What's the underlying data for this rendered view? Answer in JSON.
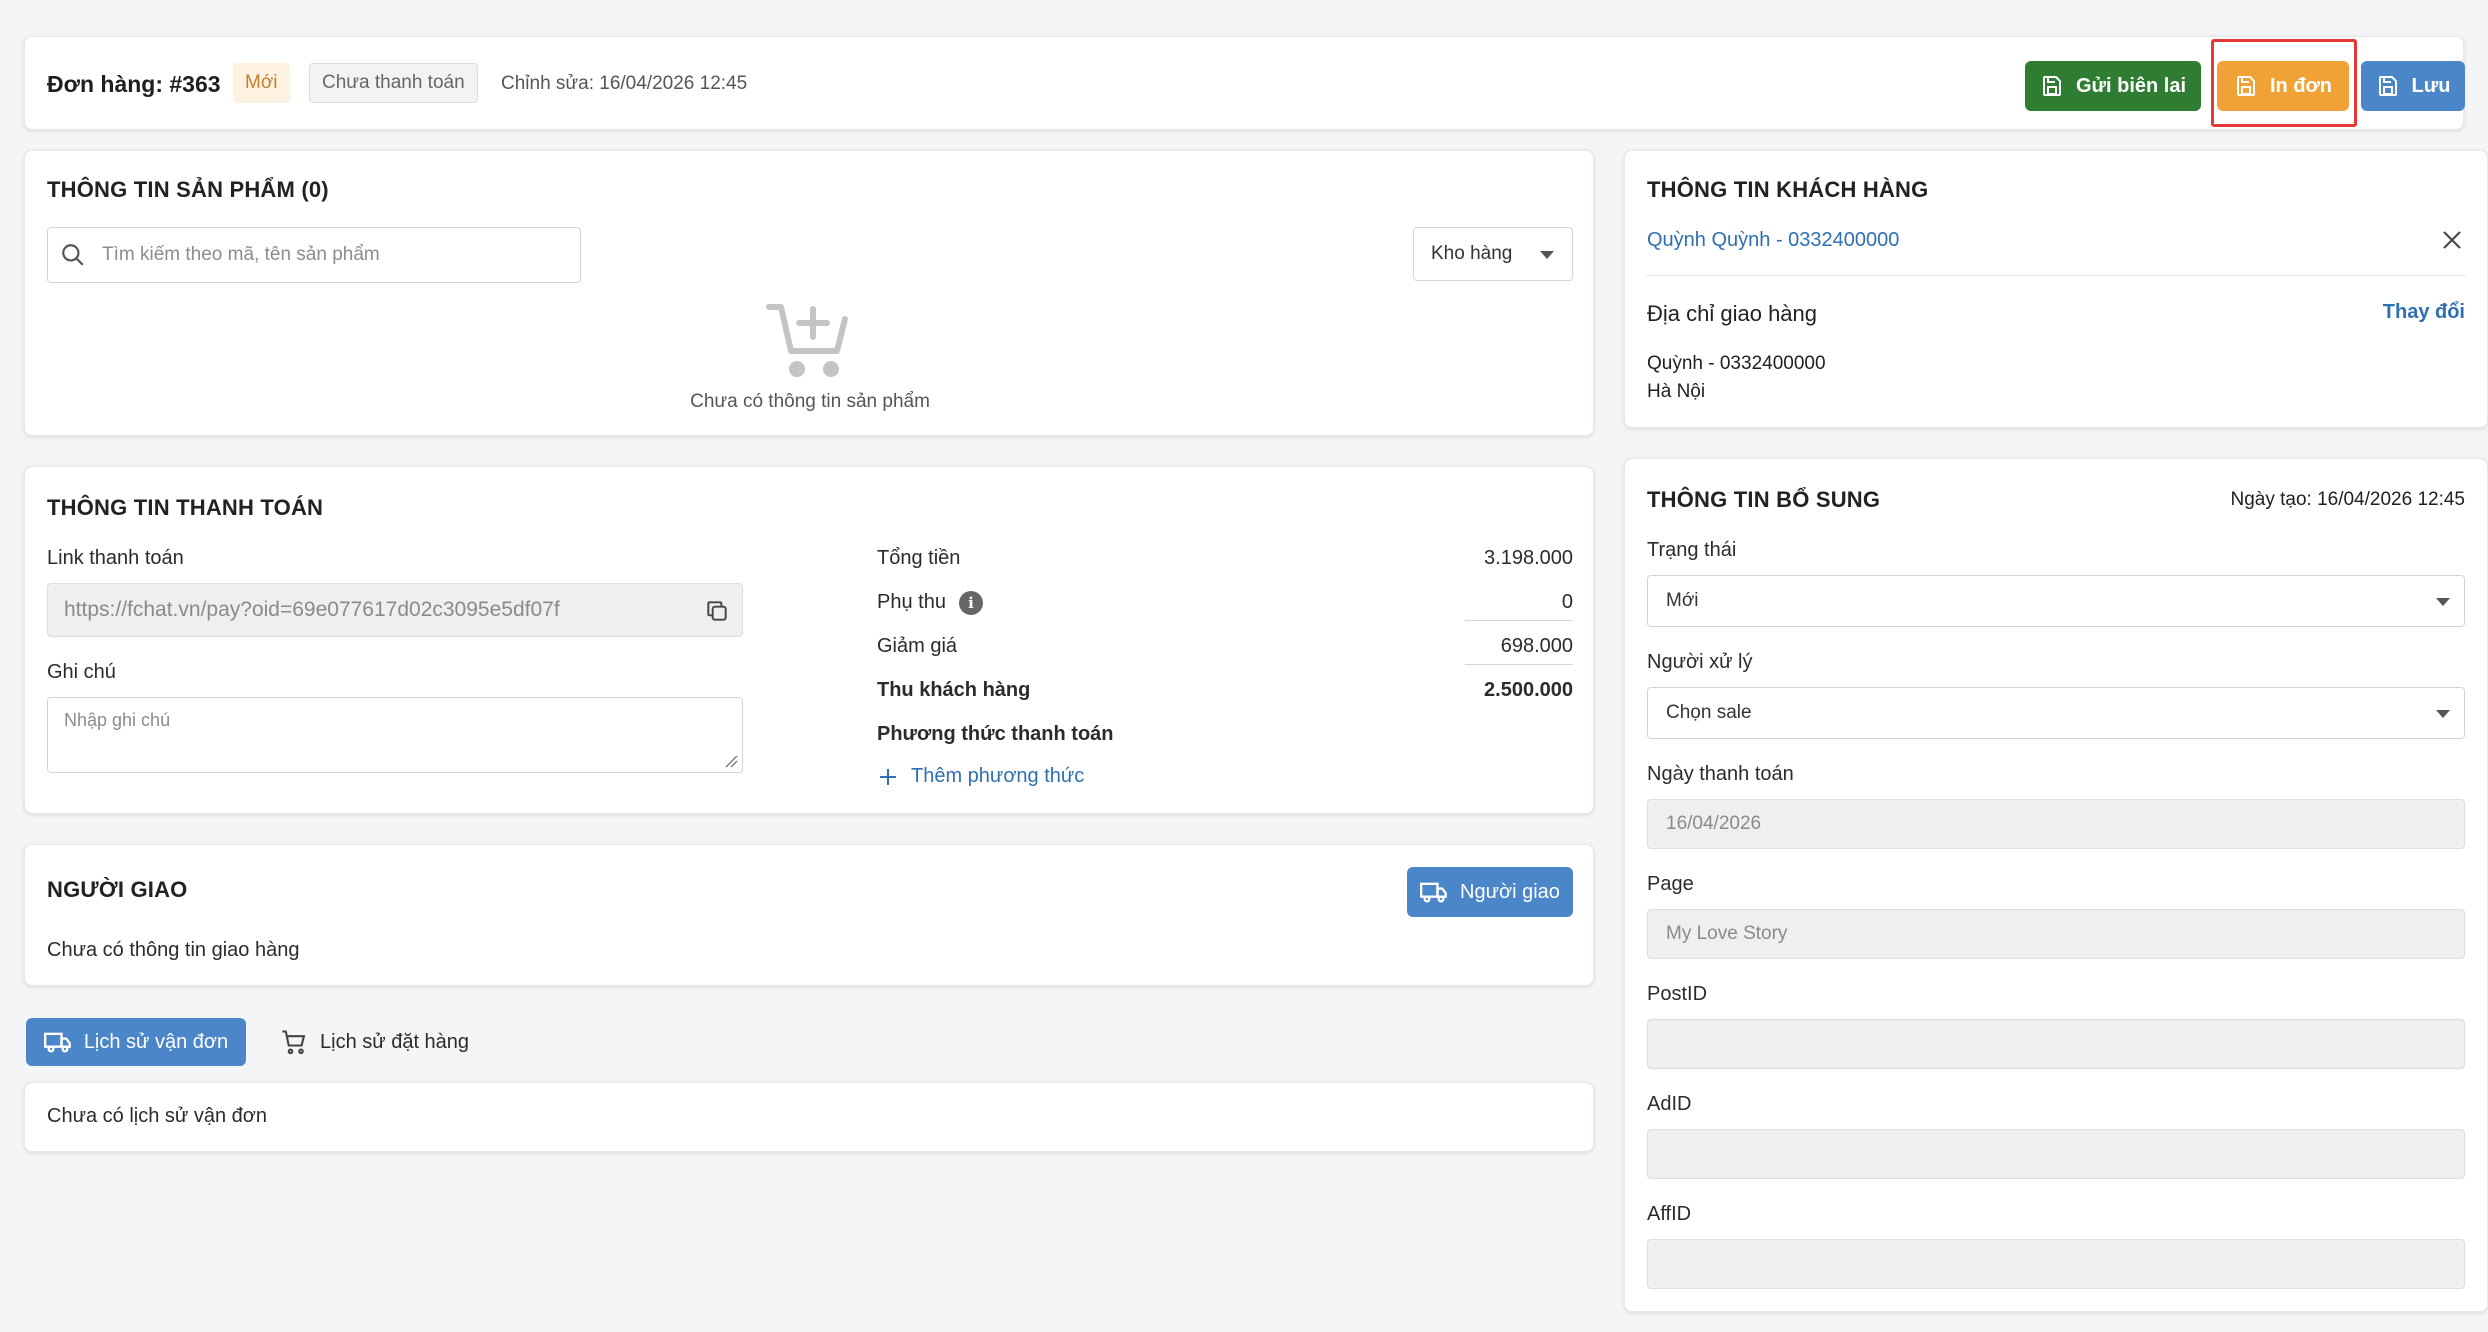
{
  "header": {
    "order_label": "Đơn hàng: #363",
    "badge_status": "Mới",
    "badge_payment": "Chưa thanh toán",
    "edited": "Chỉnh sửa: 16/04/2026 12:45",
    "send_receipt_label": "Gửi biên lai",
    "print_label": "In đơn",
    "save_label": "Lưu"
  },
  "products": {
    "title": "THÔNG TIN SẢN PHẨM (0)",
    "search_placeholder": "Tìm kiếm theo mã, tên sản phẩm",
    "warehouse_label": "Kho hàng",
    "empty_text": "Chưa có thông tin sản phẩm"
  },
  "payment": {
    "title": "THÔNG TIN THANH TOÁN",
    "link_label": "Link thanh toán",
    "link_value": "https://fchat.vn/pay?oid=69e077617d02c3095e5df07f",
    "note_label": "Ghi chú",
    "note_placeholder": "Nhập ghi chú",
    "total_label": "Tổng tiền",
    "total_value": "3.198.000",
    "surcharge_label": "Phụ thu",
    "surcharge_value": "0",
    "discount_label": "Giảm giá",
    "discount_value": "698.000",
    "collect_label": "Thu khách hàng",
    "collect_value": "2.500.000",
    "method_label": "Phương thức thanh toán",
    "add_method_label": "Thêm phương thức"
  },
  "shipper": {
    "title": "NGƯỜI GIAO",
    "button_label": "Người giao",
    "empty_text": "Chưa có thông tin giao hàng"
  },
  "history": {
    "tab_shipping": "Lịch sử vận đơn",
    "tab_orders": "Lịch sử đặt hàng",
    "empty_text": "Chưa có lịch sử vận đơn"
  },
  "customer": {
    "title": "THÔNG TIN KHÁCH HÀNG",
    "name_phone": "Quỳnh Quỳnh - 0332400000",
    "address_title": "Địa chỉ giao hàng",
    "change_label": "Thay đổi",
    "address_line1": "Quỳnh - 0332400000",
    "address_line2": "Hà Nội"
  },
  "extra": {
    "title": "THÔNG TIN BỔ SUNG",
    "created": "Ngày tạo: 16/04/2026 12:45",
    "status_label": "Trạng thái",
    "status_value": "Mới",
    "handler_label": "Người xử lý",
    "handler_value": "Chọn sale",
    "pay_date_label": "Ngày thanh toán",
    "pay_date_value": "16/04/2026",
    "page_label": "Page",
    "page_value": "My Love Story",
    "postid_label": "PostID",
    "postid_value": "",
    "adid_label": "AdID",
    "adid_value": "",
    "affid_label": "AffID",
    "affid_value": ""
  },
  "colors": {
    "green": "#2e7d32",
    "orange": "#f0a236",
    "blue": "#4a86c8",
    "highlight": "#e53935",
    "link": "#2f6fb3"
  }
}
